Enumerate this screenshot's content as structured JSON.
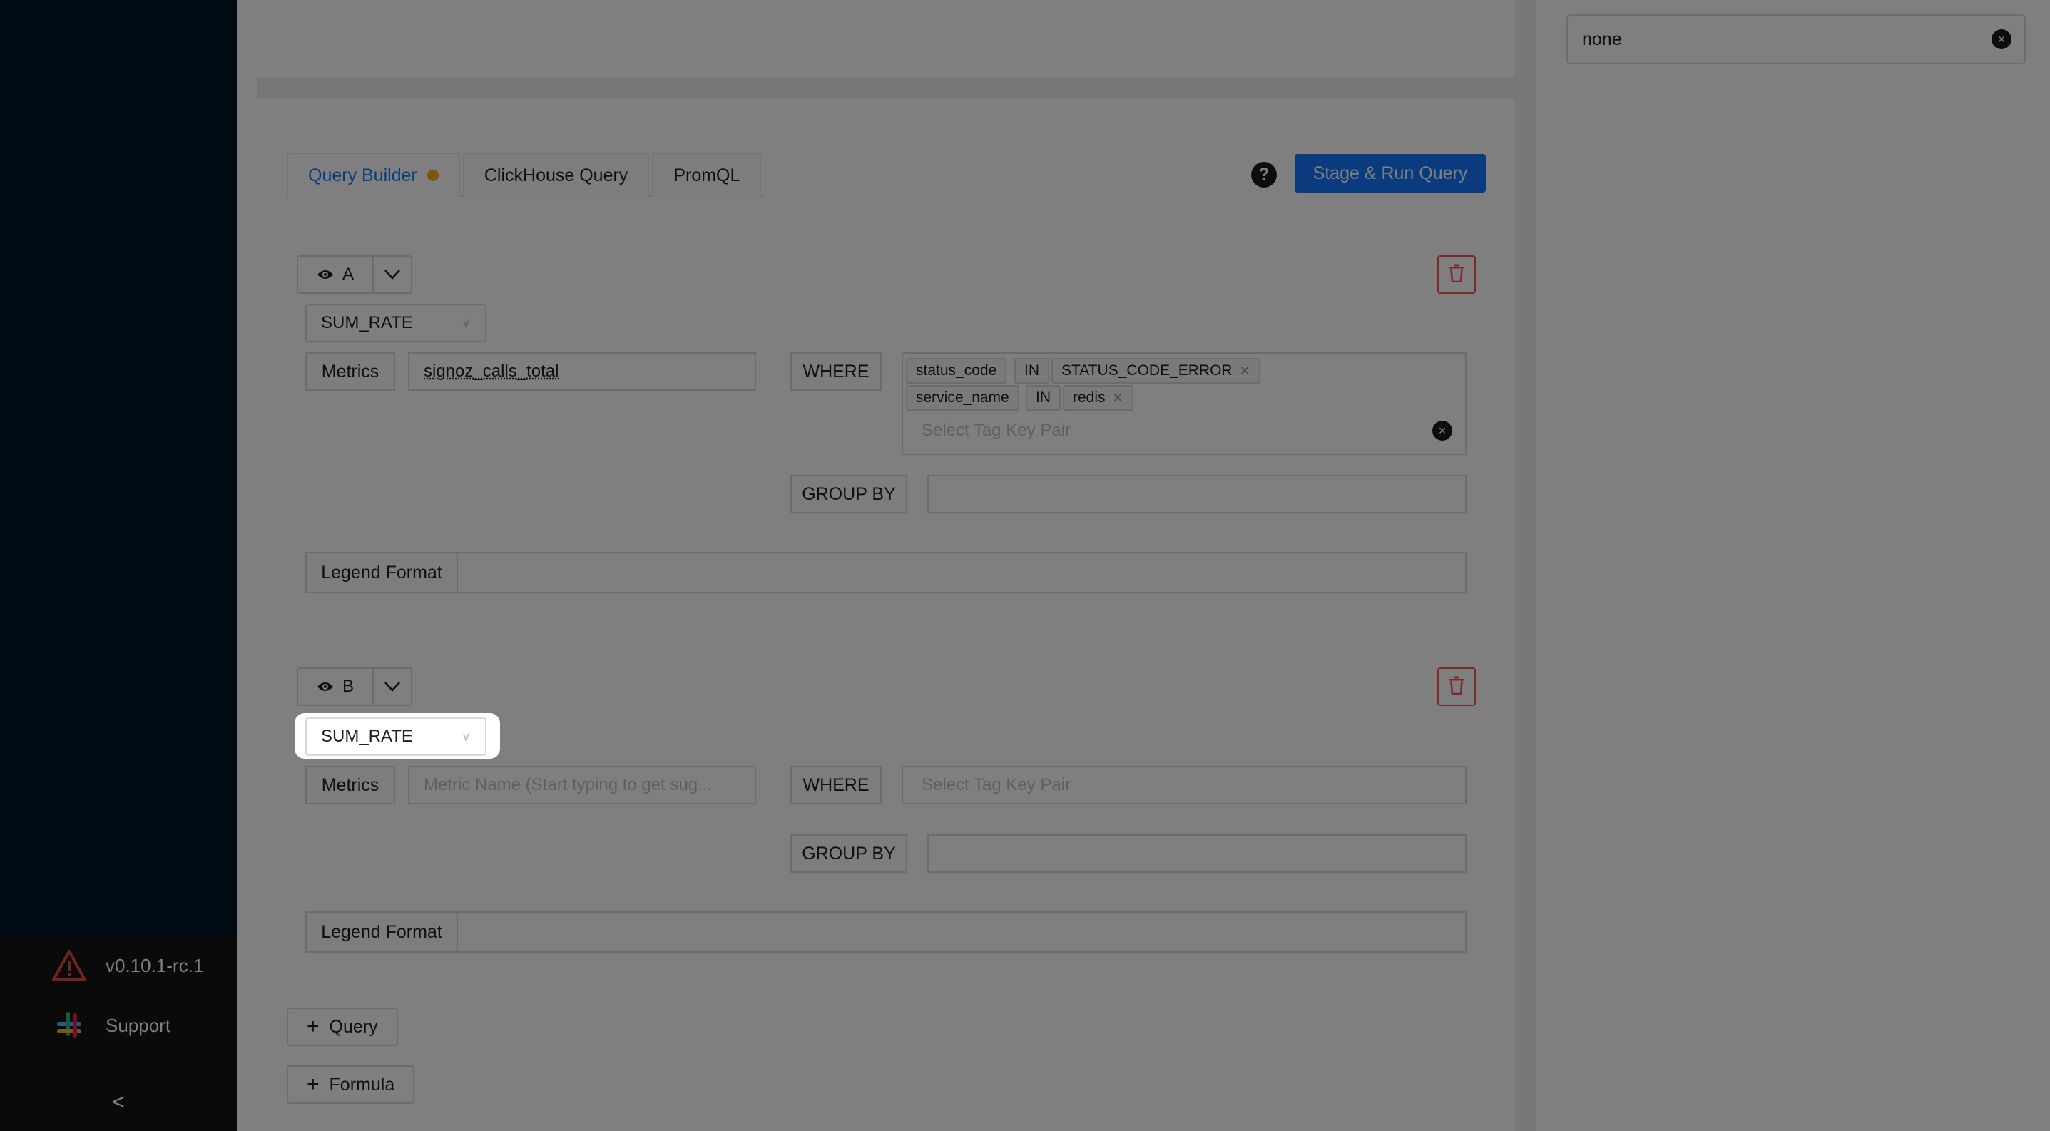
{
  "sidebar": {
    "version_label": "v0.10.1-rc.1",
    "support_label": "Support",
    "collapse_glyph": "<"
  },
  "right_panel": {
    "unit_value": "none",
    "clear_glyph": "×"
  },
  "tabs": [
    {
      "label": "Query Builder"
    },
    {
      "label": "ClickHouse Query"
    },
    {
      "label": "PromQL"
    }
  ],
  "toolbar": {
    "help_glyph": "?",
    "run_label": "Stage & Run Query"
  },
  "queries": [
    {
      "name": "A",
      "aggregation": "SUM_RATE",
      "metrics_label": "Metrics",
      "metric_value": "signoz_calls_total",
      "where_label": "WHERE",
      "tags": [
        {
          "key": "status_code",
          "op": "IN",
          "value": "STATUS_CODE_ERROR"
        },
        {
          "key": "service_name",
          "op": "IN",
          "value": "redis"
        }
      ],
      "tag_placeholder": "Select Tag Key Pair",
      "group_by_label": "GROUP BY",
      "legend_label": "Legend Format"
    },
    {
      "name": "B",
      "aggregation": "SUM_RATE",
      "metrics_label": "Metrics",
      "metric_placeholder": "Metric Name (Start typing to get sug...",
      "where_label": "WHERE",
      "tag_placeholder": "Select Tag Key Pair",
      "group_by_label": "GROUP BY",
      "legend_label": "Legend Format"
    }
  ],
  "actions": {
    "add_query_label": "Query",
    "add_formula_label": "Formula",
    "plus_glyph": "+"
  },
  "colors": {
    "primary": "#1677ff",
    "sidebar_bg": "#001529",
    "danger": "#ff4d4f",
    "unsaved_dot": "#faad14"
  }
}
